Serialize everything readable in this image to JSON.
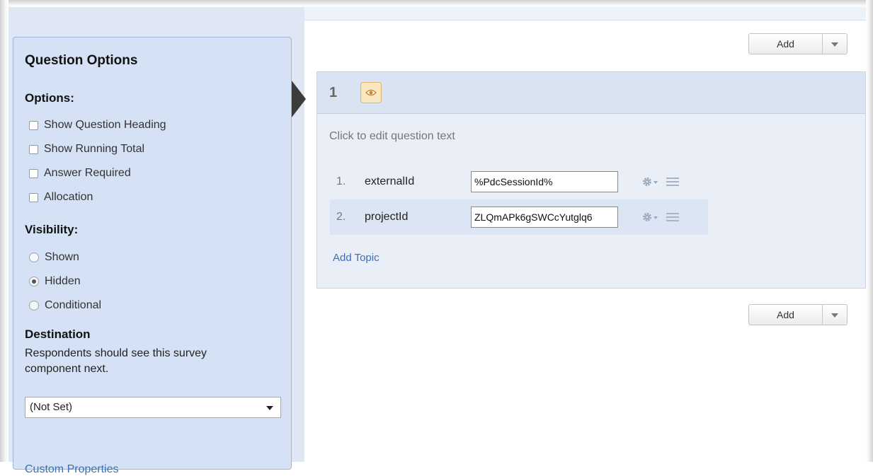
{
  "sidebar": {
    "panel_title": "Question Options",
    "options_heading": "Options:",
    "options": [
      {
        "label": "Show Question Heading",
        "checked": false
      },
      {
        "label": "Show Running Total",
        "checked": false
      },
      {
        "label": "Answer Required",
        "checked": false
      },
      {
        "label": "Allocation",
        "checked": false
      }
    ],
    "visibility_heading": "Visibility:",
    "visibility": [
      {
        "label": "Shown",
        "selected": false
      },
      {
        "label": "Hidden",
        "selected": true
      },
      {
        "label": "Conditional",
        "selected": false
      }
    ],
    "destination_heading": "Destination",
    "destination_desc": "Respondents should see this survey component next.",
    "destination_value": "(Not Set)",
    "custom_properties": "Custom Properties"
  },
  "main": {
    "add_label": "Add",
    "question": {
      "number": "1",
      "text_placeholder": "Click to edit question text",
      "topics": [
        {
          "index": "1.",
          "name": "externalId",
          "value": "%PdcSessionId%"
        },
        {
          "index": "2.",
          "name": "projectId",
          "value": "ZLQmAPk6gSWCcYutglq6"
        }
      ],
      "add_topic": "Add Topic"
    }
  },
  "icons": {
    "visibility": "eye-icon",
    "topic_settings": "gear-icon",
    "topic_drag": "drag-handle-icon",
    "dropdown": "chevron-down-icon",
    "panel_pointer": "pointer-arrow-icon"
  },
  "colors": {
    "panel_bg": "#d5e1f4",
    "link": "#3b6fb6",
    "eye_button": "#fbe6c2"
  }
}
